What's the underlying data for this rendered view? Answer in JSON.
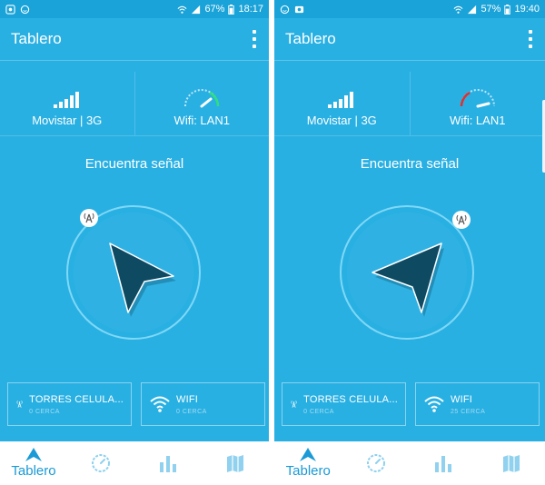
{
  "screens": [
    {
      "status": {
        "battery": "67%",
        "time": "18:17"
      },
      "title": "Tablero",
      "carrier_label": "Movistar | 3G",
      "wifi_label": "Wifi: LAN1",
      "find_label": "Encuentra señal",
      "towers": {
        "title": "TORRES CELULA...",
        "sub": "0 CERCA"
      },
      "wifi": {
        "title": "WIFI",
        "sub": "0 CERCA"
      },
      "nav_label": "Tablero"
    },
    {
      "status": {
        "battery": "57%",
        "time": "19:40"
      },
      "title": "Tablero",
      "carrier_label": "Movistar | 3G",
      "wifi_label": "Wifi: LAN1",
      "find_label": "Encuentra señal",
      "towers": {
        "title": "TORRES CELULA...",
        "sub": "0 CERCA"
      },
      "wifi": {
        "title": "WIFI",
        "sub": "25 CERCA"
      },
      "nav_label": "Tablero"
    }
  ],
  "colors": {
    "background": "#29b0e3",
    "statusbar": "#1aa3d8",
    "arrow": "#0f4a63",
    "nav_active": "#1a9ad6",
    "nav_inactive": "#8fd1ee",
    "gauge_good": "#2ee07a",
    "gauge_bad": "#e0302e"
  },
  "icons": {
    "status_left": [
      "alarm-icon",
      "notification-icon"
    ],
    "status_right": [
      "wifi-status-icon",
      "signal-status-icon",
      "battery-icon"
    ],
    "nav": [
      "dashboard-arrow-icon",
      "speedometer-icon",
      "bar-chart-icon",
      "map-icon"
    ],
    "cards": [
      "cell-tower-icon",
      "wifi-icon"
    ]
  }
}
